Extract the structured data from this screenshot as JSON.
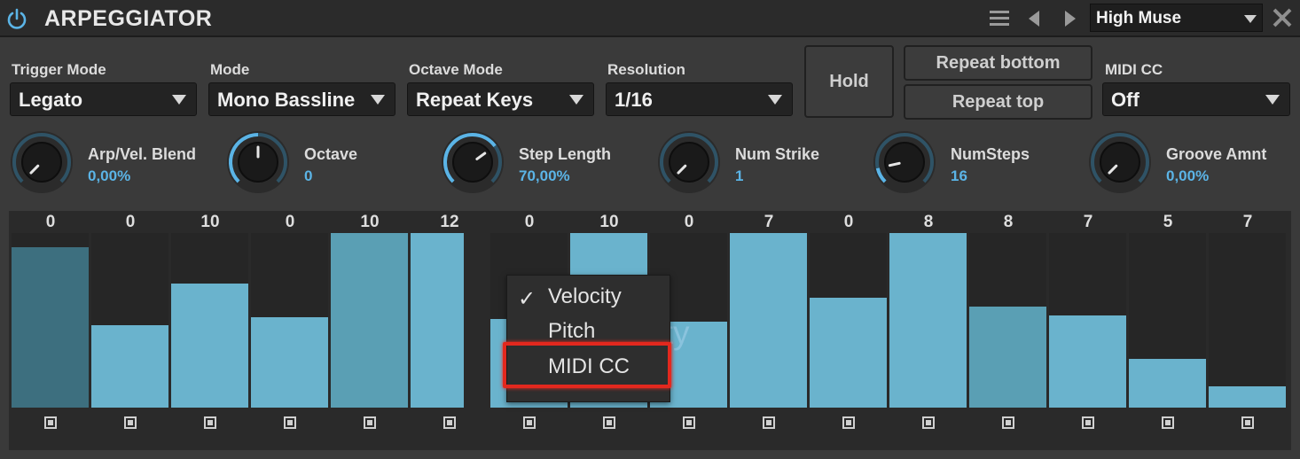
{
  "header": {
    "title": "ARPEGGIATOR",
    "preset": "High Muse",
    "power_icon": "power-icon",
    "menu_icon": "hamburger-menu-icon",
    "prev_icon": "triangle-left-icon",
    "next_icon": "triangle-right-icon",
    "close_icon": "close-icon"
  },
  "controls": {
    "trigger_mode": {
      "label": "Trigger Mode",
      "value": "Legato"
    },
    "mode": {
      "label": "Mode",
      "value": "Mono Bassline"
    },
    "octave_mode": {
      "label": "Octave Mode",
      "value": "Repeat Keys"
    },
    "resolution": {
      "label": "Resolution",
      "value": "1/16"
    },
    "hold": "Hold",
    "repeat_bottom": "Repeat bottom",
    "repeat_top": "Repeat top",
    "midi_cc": {
      "label": "MIDI CC",
      "value": "Off"
    }
  },
  "knobs": [
    {
      "name": "Arp/Vel. Blend",
      "value": "0,00%",
      "level": 0.0
    },
    {
      "name": "Octave",
      "value": "0",
      "level": 0.5
    },
    {
      "name": "Step Length",
      "value": "70,00%",
      "level": 0.7
    },
    {
      "name": "Num Strike",
      "value": "1",
      "level": 0.0
    },
    {
      "name": "NumSteps",
      "value": "16",
      "level": 0.12
    },
    {
      "name": "Groove Amnt",
      "value": "0,00%",
      "level": 0.0
    }
  ],
  "steps": [
    {
      "label": "0",
      "level": 0.92
    },
    {
      "label": "0",
      "level": 0.47
    },
    {
      "label": "10",
      "level": 0.71
    },
    {
      "label": "0",
      "level": 0.52
    },
    {
      "label": "10",
      "level": 1.0
    },
    {
      "label": "12",
      "level": 1.0
    },
    {
      "label": "0",
      "level": 0.51
    },
    {
      "label": "10",
      "level": 1.0
    },
    {
      "label": "0",
      "level": 0.49
    },
    {
      "label": "7",
      "level": 1.0
    },
    {
      "label": "0",
      "level": 0.63
    },
    {
      "label": "8",
      "level": 1.0
    },
    {
      "label": "8",
      "level": 0.58
    },
    {
      "label": "7",
      "level": 0.53
    },
    {
      "label": "5",
      "level": 0.28
    },
    {
      "label": "7",
      "level": 0.12
    }
  ],
  "colors": {
    "bar": "#6ab3cd",
    "bar_dim": "#5a9fb4",
    "bar_dark": "#3d6f7f",
    "accent": "#5bb4e6",
    "highlight": "#e3281e"
  },
  "overlay_text": "Velocity",
  "context_menu": {
    "items": [
      {
        "label": "Velocity",
        "checked": true
      },
      {
        "label": "Pitch",
        "checked": false
      },
      {
        "label": "MIDI CC",
        "checked": false
      }
    ],
    "check_mark": "✓"
  }
}
